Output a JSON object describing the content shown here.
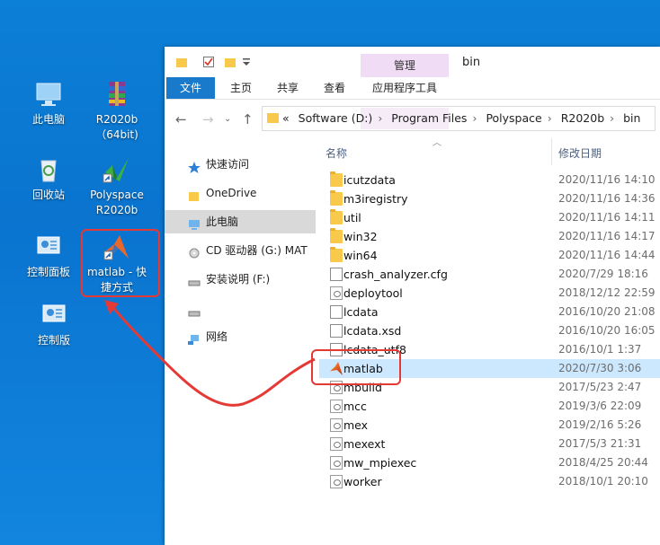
{
  "desktop": {
    "icons": [
      {
        "label": "此电脑",
        "icon": "this-pc-icon"
      },
      {
        "label": "R2020b（64bit)",
        "icon": "winrar-archive-icon"
      },
      {
        "label": "回收站",
        "icon": "recycle-bin-icon"
      },
      {
        "label": "Polyspace R2020b",
        "icon": "polyspace-icon"
      },
      {
        "label": "控制面板",
        "icon": "control-panel-icon"
      },
      {
        "label": "matlab - 快捷方式",
        "icon": "matlab-shortcut-icon"
      },
      {
        "label": "控制版",
        "icon": "control-panel-icon"
      }
    ]
  },
  "window": {
    "title": "bin",
    "ribbon_context": "管理",
    "tabs": [
      "文件",
      "主页",
      "共享",
      "查看",
      "应用程序工具"
    ],
    "breadcrumb": [
      "«",
      "Software (D:)",
      "Program Files",
      "Polyspace",
      "R2020b",
      "bin"
    ],
    "nav": [
      {
        "label": "快速访问",
        "icon": "star-icon"
      },
      {
        "label": "OneDrive",
        "icon": "folder-icon"
      },
      {
        "label": "此电脑",
        "icon": "computer-icon",
        "selected": true
      },
      {
        "label": "CD 驱动器 (G:) MAT",
        "icon": "cd-drive-icon"
      },
      {
        "label": "安装说明 (F:)",
        "icon": "drive-icon"
      },
      {
        "label": "",
        "icon": "drive-icon"
      },
      {
        "label": "网络",
        "icon": "network-icon"
      }
    ],
    "columns": {
      "name": "名称",
      "date": "修改日期"
    },
    "files": [
      {
        "name": "icutzdata",
        "date": "2020/11/16 14:10",
        "type": "folder"
      },
      {
        "name": "m3iregistry",
        "date": "2020/11/16 14:36",
        "type": "folder"
      },
      {
        "name": "util",
        "date": "2020/11/16 14:11",
        "type": "folder"
      },
      {
        "name": "win32",
        "date": "2020/11/16 14:17",
        "type": "folder"
      },
      {
        "name": "win64",
        "date": "2020/11/16 14:44",
        "type": "folder"
      },
      {
        "name": "crash_analyzer.cfg",
        "date": "2020/7/29 18:16",
        "type": "doc"
      },
      {
        "name": "deploytool",
        "date": "2018/12/12 22:59",
        "type": "app"
      },
      {
        "name": "lcdata",
        "date": "2016/10/20 21:08",
        "type": "doc"
      },
      {
        "name": "lcdata.xsd",
        "date": "2016/10/20 16:05",
        "type": "doc"
      },
      {
        "name": "lcdata_utf8",
        "date": "2016/10/1 1:37",
        "type": "doc"
      },
      {
        "name": "matlab",
        "date": "2020/7/30 3:06",
        "type": "matlab",
        "selected": true
      },
      {
        "name": "mbuild",
        "date": "2017/5/23 2:47",
        "type": "app"
      },
      {
        "name": "mcc",
        "date": "2019/3/6 22:09",
        "type": "app"
      },
      {
        "name": "mex",
        "date": "2019/2/16 5:26",
        "type": "app"
      },
      {
        "name": "mexext",
        "date": "2017/5/3 21:31",
        "type": "app"
      },
      {
        "name": "mw_mpiexec",
        "date": "2018/4/25 20:44",
        "type": "app"
      },
      {
        "name": "worker",
        "date": "2018/10/1 20:10",
        "type": "app"
      }
    ]
  },
  "colors": {
    "highlight": "#e53935",
    "selection": "#cce8ff",
    "file_tab": "#1979ca",
    "desktop": "#0c7fd6"
  }
}
